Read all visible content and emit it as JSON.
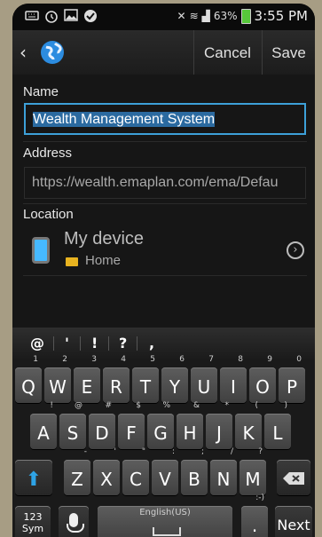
{
  "status_bar": {
    "battery": "63%",
    "time": "3:55 PM"
  },
  "action_bar": {
    "cancel_label": "Cancel",
    "save_label": "Save"
  },
  "form": {
    "name_label": "Name",
    "name_value": "Wealth Management System",
    "address_label": "Address",
    "address_value": "https://wealth.emaplan.com/ema/Defau",
    "location_label": "Location",
    "location_device": "My device",
    "location_folder": "Home"
  },
  "keyboard": {
    "symbols": [
      "@",
      "'",
      "!",
      "?",
      ","
    ],
    "row1": [
      {
        "key": "Q",
        "hint": "1"
      },
      {
        "key": "W",
        "hint": "2"
      },
      {
        "key": "E",
        "hint": "3"
      },
      {
        "key": "R",
        "hint": "4"
      },
      {
        "key": "T",
        "hint": "5"
      },
      {
        "key": "Y",
        "hint": "6"
      },
      {
        "key": "U",
        "hint": "7"
      },
      {
        "key": "I",
        "hint": "8"
      },
      {
        "key": "O",
        "hint": "9"
      },
      {
        "key": "P",
        "hint": "0"
      }
    ],
    "row2": [
      {
        "key": "A",
        "hint": "!"
      },
      {
        "key": "S",
        "hint": "@"
      },
      {
        "key": "D",
        "hint": "#"
      },
      {
        "key": "F",
        "hint": "$"
      },
      {
        "key": "G",
        "hint": "%"
      },
      {
        "key": "H",
        "hint": "&"
      },
      {
        "key": "J",
        "hint": "*"
      },
      {
        "key": "K",
        "hint": "("
      },
      {
        "key": "L",
        "hint": ")"
      }
    ],
    "row3": [
      {
        "key": "Z",
        "hint": "-"
      },
      {
        "key": "X",
        "hint": "'"
      },
      {
        "key": "C",
        "hint": "\""
      },
      {
        "key": "V",
        "hint": ":"
      },
      {
        "key": "B",
        "hint": ";"
      },
      {
        "key": "N",
        "hint": "/"
      },
      {
        "key": "M",
        "hint": "?"
      }
    ],
    "sym_key": "123\nSym",
    "language": "English(US)",
    "period_key": ".",
    "next_key": "Next"
  }
}
